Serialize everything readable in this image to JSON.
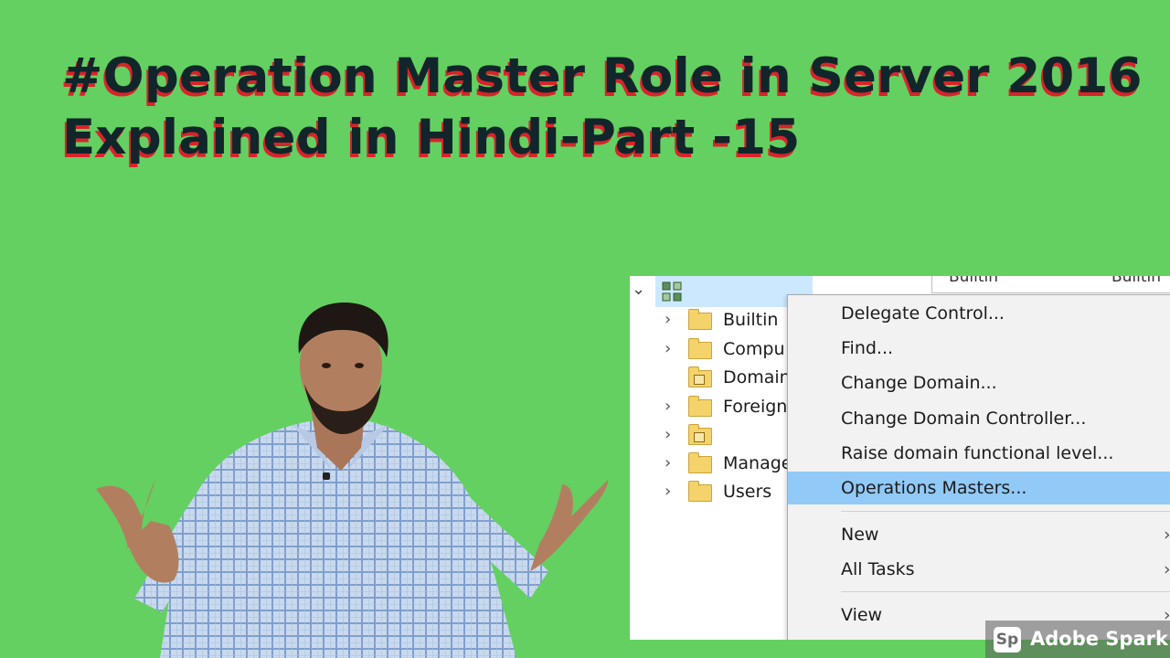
{
  "title": {
    "line1": "#Operation Master Role in Server 2016",
    "line2": "Explained in Hindi-Part -15"
  },
  "tree": {
    "root_icon": "domain-tree-icon",
    "items": [
      {
        "label": "Builtin",
        "expander": "›",
        "icon": "folder-icon"
      },
      {
        "label": "Compu",
        "expander": "›",
        "icon": "folder-icon"
      },
      {
        "label": "Domain",
        "expander": "",
        "icon": "ou-folder-icon"
      },
      {
        "label": "Foreign",
        "expander": "›",
        "icon": "folder-icon"
      },
      {
        "label": "",
        "expander": "›",
        "icon": "ou-folder-icon"
      },
      {
        "label": "Manage",
        "expander": "›",
        "icon": "folder-icon"
      },
      {
        "label": "Users",
        "expander": "›",
        "icon": "folder-icon"
      }
    ],
    "header_strip": {
      "col1": "Builtin",
      "col2": "Builtin"
    }
  },
  "context_menu": {
    "items": [
      {
        "label": "Delegate Control..."
      },
      {
        "label": "Find..."
      },
      {
        "label": "Change Domain..."
      },
      {
        "label": "Change Domain Controller..."
      },
      {
        "label": "Raise domain functional level..."
      },
      {
        "label": "Operations Masters...",
        "highlighted": true
      },
      {
        "label": "New",
        "submenu": "›"
      },
      {
        "label": "All Tasks",
        "submenu": "›"
      },
      {
        "label": "View",
        "submenu": "›"
      }
    ]
  },
  "watermark": {
    "logo": "Sp",
    "text": "Adobe Spark"
  },
  "colors": {
    "background": "#64d061",
    "title_text": "#10262b",
    "title_shadow": "#d9232a",
    "menu_highlight": "#91c9f7"
  }
}
